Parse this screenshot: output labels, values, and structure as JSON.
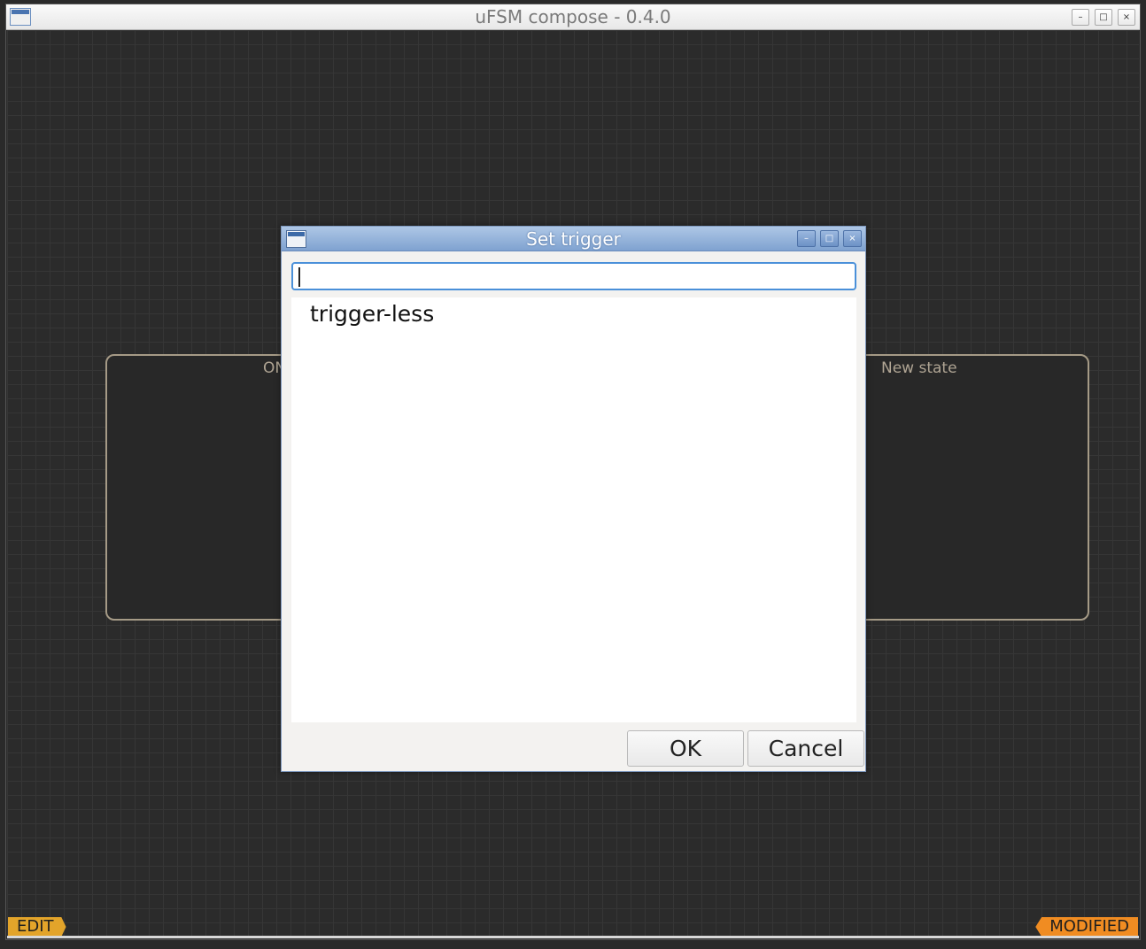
{
  "window": {
    "title": "uFSM compose - 0.4.0",
    "minimize": "–",
    "maximize": "□",
    "close": "×"
  },
  "canvas": {
    "states": [
      {
        "label": "ON"
      },
      {
        "label": "New state"
      }
    ],
    "mode_tag": "EDIT",
    "status_tag": "MODIFIED"
  },
  "dialog": {
    "title": "Set trigger",
    "search": {
      "value": "",
      "placeholder": ""
    },
    "items": [
      "trigger-less"
    ],
    "ok_label": "OK",
    "cancel_label": "Cancel",
    "minimize": "–",
    "maximize": "□",
    "close": "×"
  },
  "colors": {
    "edit_tag": "#e3a42a",
    "modified_tag": "#f08c22",
    "state_border": "#a59a86",
    "dialog_titlebar": "#8fb0da"
  }
}
